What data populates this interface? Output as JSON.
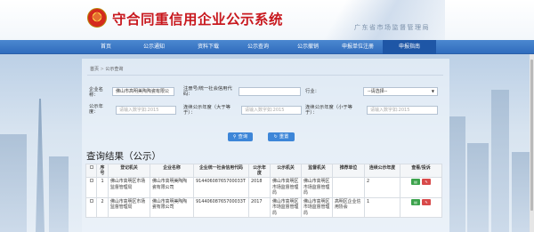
{
  "header": {
    "title": "守合同重信用企业公示系统",
    "subtitle": "广东省市场监督管理局"
  },
  "nav": {
    "items": [
      {
        "label": "首页",
        "active": false
      },
      {
        "label": "公示通知",
        "active": false
      },
      {
        "label": "资料下载",
        "active": false
      },
      {
        "label": "公示查询",
        "active": false
      },
      {
        "label": "公示撤销",
        "active": false
      },
      {
        "label": "申报单位注册",
        "active": false
      },
      {
        "label": "申报指南",
        "active": true
      }
    ]
  },
  "breadcrumb": {
    "home": "首页",
    "separator": ">",
    "current": "公示查询"
  },
  "form": {
    "company_name_label": "企业名称：",
    "company_name_value": "佛山市高明美陶陶瓷有限公",
    "credit_code_label": "注册号/统一社会信用代码：",
    "credit_code_value": "",
    "industry_label": "行业：",
    "industry_value": "--请选择--",
    "year_label": "公示年度：",
    "year_placeholder": "请输入数字如:2015",
    "consecutive_gt_label": "连续公示年度（大于等于）：",
    "consecutive_gt_placeholder": "请输入数字如:2015",
    "consecutive_lt_label": "连续公示年度（小于等于）：",
    "consecutive_lt_placeholder": "请输入数字如:2015",
    "search_button": "查询",
    "reset_button": "重置"
  },
  "results": {
    "title": "查询结果（公示）",
    "columns": [
      "",
      "序号",
      "登记机关",
      "企业名称",
      "企业统一社会信用代码",
      "公示年度",
      "公示机关",
      "监督机关",
      "推荐单位",
      "连续公示年度",
      "查看/投诉"
    ],
    "rows": [
      {
        "index": "1",
        "registration_authority": "佛山市高明区市场监督管理局",
        "company_name": "佛山市高明美陶陶瓷有限公司",
        "credit_code": "91440608765700033T",
        "year": "2018",
        "publish_authority": "佛山市高明区市场监督管理局",
        "supervisory_authority": "佛山市高明区市场监督管理局",
        "recommender": "",
        "consecutive_years": "2"
      },
      {
        "index": "2",
        "registration_authority": "佛山市高明区市场监督管理局",
        "company_name": "佛山市高明美陶陶瓷有限公司",
        "credit_code": "91440608765700033T",
        "year": "2017",
        "publish_authority": "佛山市高明区市场监督管理局",
        "supervisory_authority": "佛山市高明区市场监督管理局",
        "recommender": "高明区企业信用协会",
        "consecutive_years": "1"
      }
    ]
  },
  "colors": {
    "title_red": "#c8181e",
    "nav_blue": "#2f6cbd",
    "button_blue": "#3d86d8",
    "view_green": "#3da34d",
    "complain_red": "#d84a4a"
  }
}
